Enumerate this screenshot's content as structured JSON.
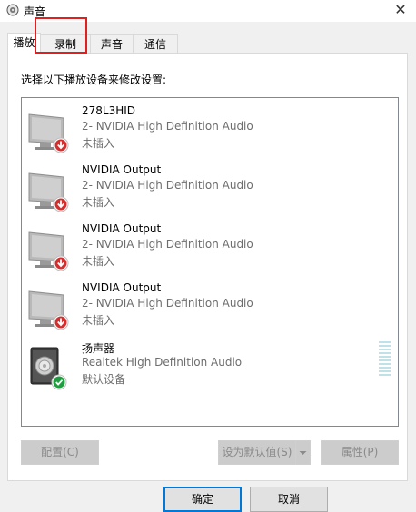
{
  "window": {
    "title": "声音",
    "close_glyph": "✕"
  },
  "tabs": [
    {
      "label": "播放",
      "active": true
    },
    {
      "label": "录制",
      "active": false
    },
    {
      "label": "声音",
      "active": false
    },
    {
      "label": "通信",
      "active": false
    }
  ],
  "instruction": "选择以下播放设备来修改设置:",
  "devices": [
    {
      "name": "278L3HID",
      "description": "2- NVIDIA High Definition Audio",
      "status": "未插入",
      "icon": "monitor-icon",
      "badge": "unplugged-badge-icon"
    },
    {
      "name": "NVIDIA Output",
      "description": "2- NVIDIA High Definition Audio",
      "status": "未插入",
      "icon": "monitor-icon",
      "badge": "unplugged-badge-icon"
    },
    {
      "name": "NVIDIA Output",
      "description": "2- NVIDIA High Definition Audio",
      "status": "未插入",
      "icon": "monitor-icon",
      "badge": "unplugged-badge-icon"
    },
    {
      "name": "NVIDIA Output",
      "description": "2- NVIDIA High Definition Audio",
      "status": "未插入",
      "icon": "monitor-icon",
      "badge": "unplugged-badge-icon"
    },
    {
      "name": "扬声器",
      "description": "Realtek High Definition Audio",
      "status": "默认设备",
      "icon": "speaker-icon",
      "badge": "default-check-icon"
    }
  ],
  "buttons": {
    "configure": "配置(C)",
    "set_default": "设为默认值(S)",
    "properties": "属性(P)",
    "ok": "确定",
    "cancel": "取消"
  },
  "colors": {
    "unplugged_badge": "#d32f2f",
    "default_badge": "#1e9e3e",
    "highlight_box": "#e02020",
    "level_meter": "#bfe2e8"
  }
}
